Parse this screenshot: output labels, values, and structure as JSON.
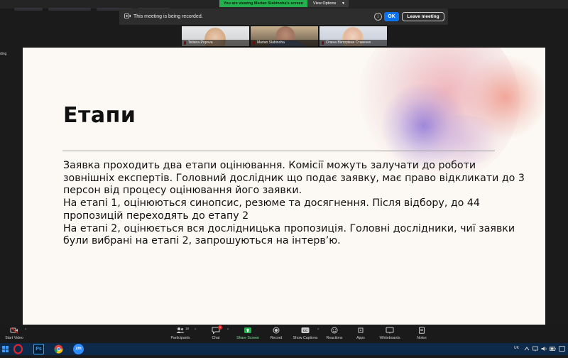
{
  "topbar": {
    "viewing_text": "You are viewing Marian Slabinoha's screen",
    "view_options": "View Options"
  },
  "recording": {
    "message": "This meeting is being recorded.",
    "ok": "OK",
    "leave": "Leave meeting"
  },
  "participants": [
    {
      "name": "Tetiana Popova"
    },
    {
      "name": "Marian Slabinoha"
    },
    {
      "name": "Олена Вікторівна Ставенко"
    }
  ],
  "side_fragment": "ding",
  "slide": {
    "title": "Етапи",
    "paragraphs": [
      "Заявка проходить два етапи оцінювання. Комісії можуть залучати до роботи зовнішніх експертів. Головний дослідник що подає заявку, має право відкликати до 3 персон від процесу оцінювання його заявки.",
      "На етапі 1, оцінюються синопсис, резюме та досягнення. Після відбору, до 44 пропозицій переходять до етапу 2",
      "На етапі 2, оцінюється вся дослідницька пропозиція. Головні дослідники, чиї заявки були вибрані на етапі 2, запрошуються на інтерв’ю."
    ]
  },
  "toolbar": {
    "start_video": "Start Video",
    "participants": "Participants",
    "participants_count": "18",
    "chat": "Chat",
    "chat_badge": "1",
    "share_screen": "Share Screen",
    "record": "Record",
    "show_captions": "Show Captions",
    "reactions": "Reactions",
    "apps": "Apps",
    "whiteboards": "Whiteboards",
    "notes": "Notes"
  },
  "taskbar": {
    "language": "UK",
    "apps": [
      "opera-icon",
      "photoshop-icon",
      "chrome-icon",
      "zoom-icon"
    ],
    "photoshop_label": "Ps",
    "zoom_label": "zm"
  },
  "colors": {
    "share_green": "#22b14c",
    "ok_blue": "#0e72ed",
    "slide_bg": "#fcf8f3"
  }
}
